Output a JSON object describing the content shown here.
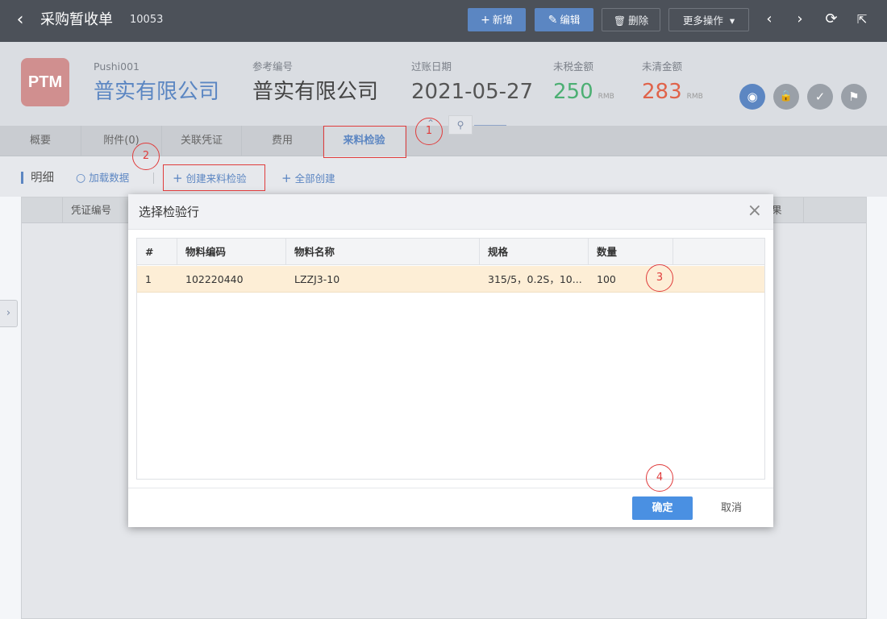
{
  "topbar": {
    "back_icon": "‹",
    "title": "采购暂收单",
    "doc_no": "10053",
    "buttons": {
      "new": "新增",
      "edit": "编辑",
      "delete": "删除",
      "more": "更多操作"
    },
    "icons": {
      "plus": "+",
      "edit": "✎",
      "trash": "🗑",
      "caret": "▾",
      "prev": "‹",
      "next": "›",
      "refresh": "⟳",
      "share": "⇱"
    }
  },
  "header": {
    "logo": "PTM",
    "fields": [
      {
        "label": "Pushi001",
        "value": "普实有限公司",
        "unit": ""
      },
      {
        "label": "参考编号",
        "value": "普实有限公司",
        "unit": ""
      },
      {
        "label": "过账日期",
        "value": "2021-05-27",
        "unit": ""
      },
      {
        "label": "未税金额",
        "value": "250",
        "unit": "RMB"
      },
      {
        "label": "未清金额",
        "value": "283",
        "unit": "RMB"
      }
    ],
    "status_icons": [
      "◉",
      "🔒",
      "✓",
      "⚑"
    ],
    "colors": {
      "link_blue": "#5b86c2",
      "green": "#4caf73",
      "red": "#e0634a"
    }
  },
  "tabs": [
    "概要",
    "附件(0)",
    "关联凭证",
    "费用",
    "来料检验"
  ],
  "tabs_active": "来料检验",
  "pin_icon": "⚲",
  "collapse_icon": "⌃",
  "toolbar": {
    "title": "明细",
    "load": "加载数据",
    "create_inspection": "创建来料检验",
    "create_all": "全部创建",
    "search_icon": "○",
    "plus_icon": "+"
  },
  "grid": {
    "col1": "凭证编号",
    "col_last": "果",
    "side_icon": "›"
  },
  "modal": {
    "title": "选择检验行",
    "close_icon": "×",
    "columns": [
      "#",
      "物料编码",
      "物料名称",
      "规格",
      "数量"
    ],
    "rows": [
      {
        "no": "1",
        "code": "102220440",
        "name": "LZZJ3-10",
        "spec": "315/5，0.2S，10...",
        "qty": "100"
      }
    ],
    "ok": "确定",
    "cancel": "取消"
  },
  "annotations": [
    "1",
    "2",
    "3",
    "4"
  ]
}
